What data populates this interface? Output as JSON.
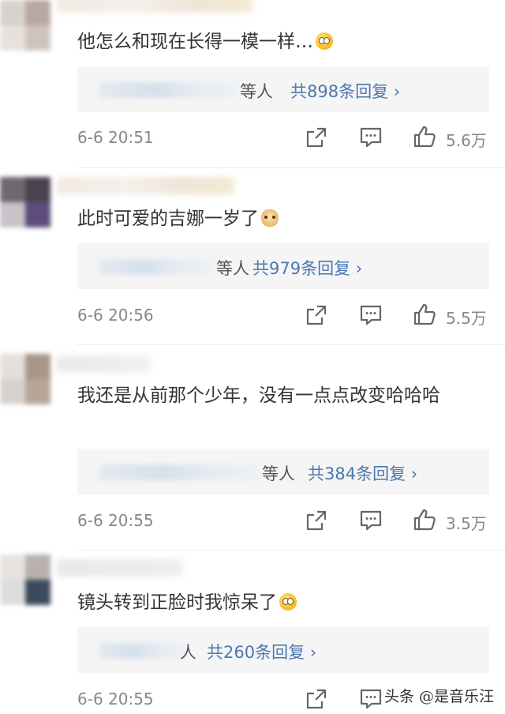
{
  "comments": [
    {
      "text": "他怎么和现在长得一模一样…",
      "emoji": "flushed-emoji",
      "reply_who": "等人",
      "reply_count": "共898条回复 ›",
      "time": "6-6 20:51",
      "likes": "5.6万"
    },
    {
      "text": "此时可爱的吉娜一岁了",
      "emoji": "doge-emoji",
      "reply_who": "等人",
      "reply_count": "共979条回复 ›",
      "time": "6-6 20:56",
      "likes": "5.5万"
    },
    {
      "text": "我还是从前那个少年，没有一点点改变哈哈哈",
      "emoji": "",
      "reply_who": "等人",
      "reply_count": "共384条回复 ›",
      "time": "6-6 20:55",
      "likes": "3.5万"
    },
    {
      "text": "镜头转到正脸时我惊呆了",
      "emoji": "flushed-emoji",
      "reply_who": "人",
      "reply_count": "共260条回复 ›",
      "time": "6-6 20:55",
      "likes": ""
    }
  ],
  "watermark": "头条 @是音乐汪",
  "icons": {
    "share": "share-icon",
    "comment": "comment-icon",
    "like": "thumbs-up-icon"
  },
  "colors": {
    "link": "#4a78b0",
    "meta": "#888888",
    "reply_bg": "#f5f5f5"
  }
}
